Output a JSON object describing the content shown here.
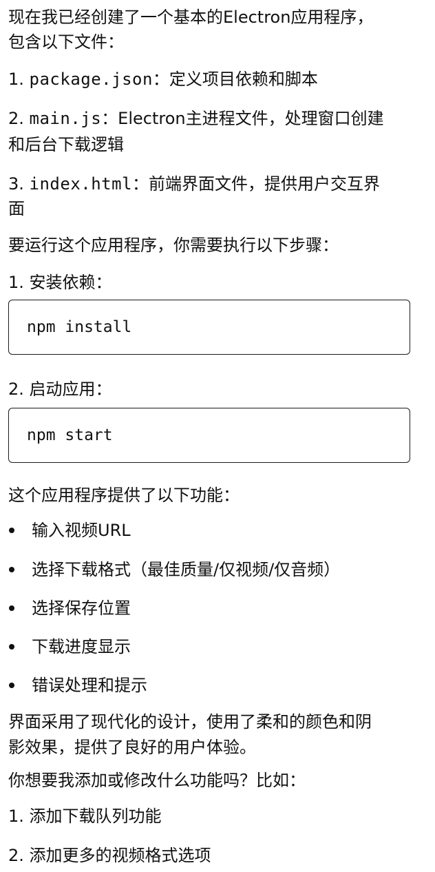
{
  "intro": {
    "line1": "现在我已经创建了一个基本的Electron应用程序，",
    "line2": "包含以下文件："
  },
  "files": [
    {
      "num": "1. ",
      "code": "package.json",
      "desc": "：定义项目依赖和脚本"
    },
    {
      "num": "2. ",
      "code": "main.js",
      "desc": "：Electron主进程文件，处理窗口创建",
      "desc2": "和后台下载逻辑"
    },
    {
      "num": "3. ",
      "code": "index.html",
      "desc": "：前端界面文件，提供用户交互界",
      "desc2": "面"
    }
  ],
  "run_heading": "要运行这个应用程序，你需要执行以下步骤：",
  "steps": [
    {
      "label": "1. 安装依赖：",
      "command": "npm install"
    },
    {
      "label": "2. 启动应用：",
      "command": "npm start"
    }
  ],
  "features_heading": "这个应用程序提供了以下功能：",
  "features": [
    "输入视频URL",
    "选择下载格式（最佳质量/仅视频/仅音频）",
    "选择保存位置",
    "下载进度显示",
    "错误处理和提示"
  ],
  "design": {
    "line1": "界面采用了现代化的设计，使用了柔和的颜色和阴",
    "line2": "影效果，提供了良好的用户体验。"
  },
  "question": "你想要我添加或修改什么功能吗？比如：",
  "suggestions": [
    "1. 添加下载队列功能",
    "2. 添加更多的视频格式选项"
  ]
}
